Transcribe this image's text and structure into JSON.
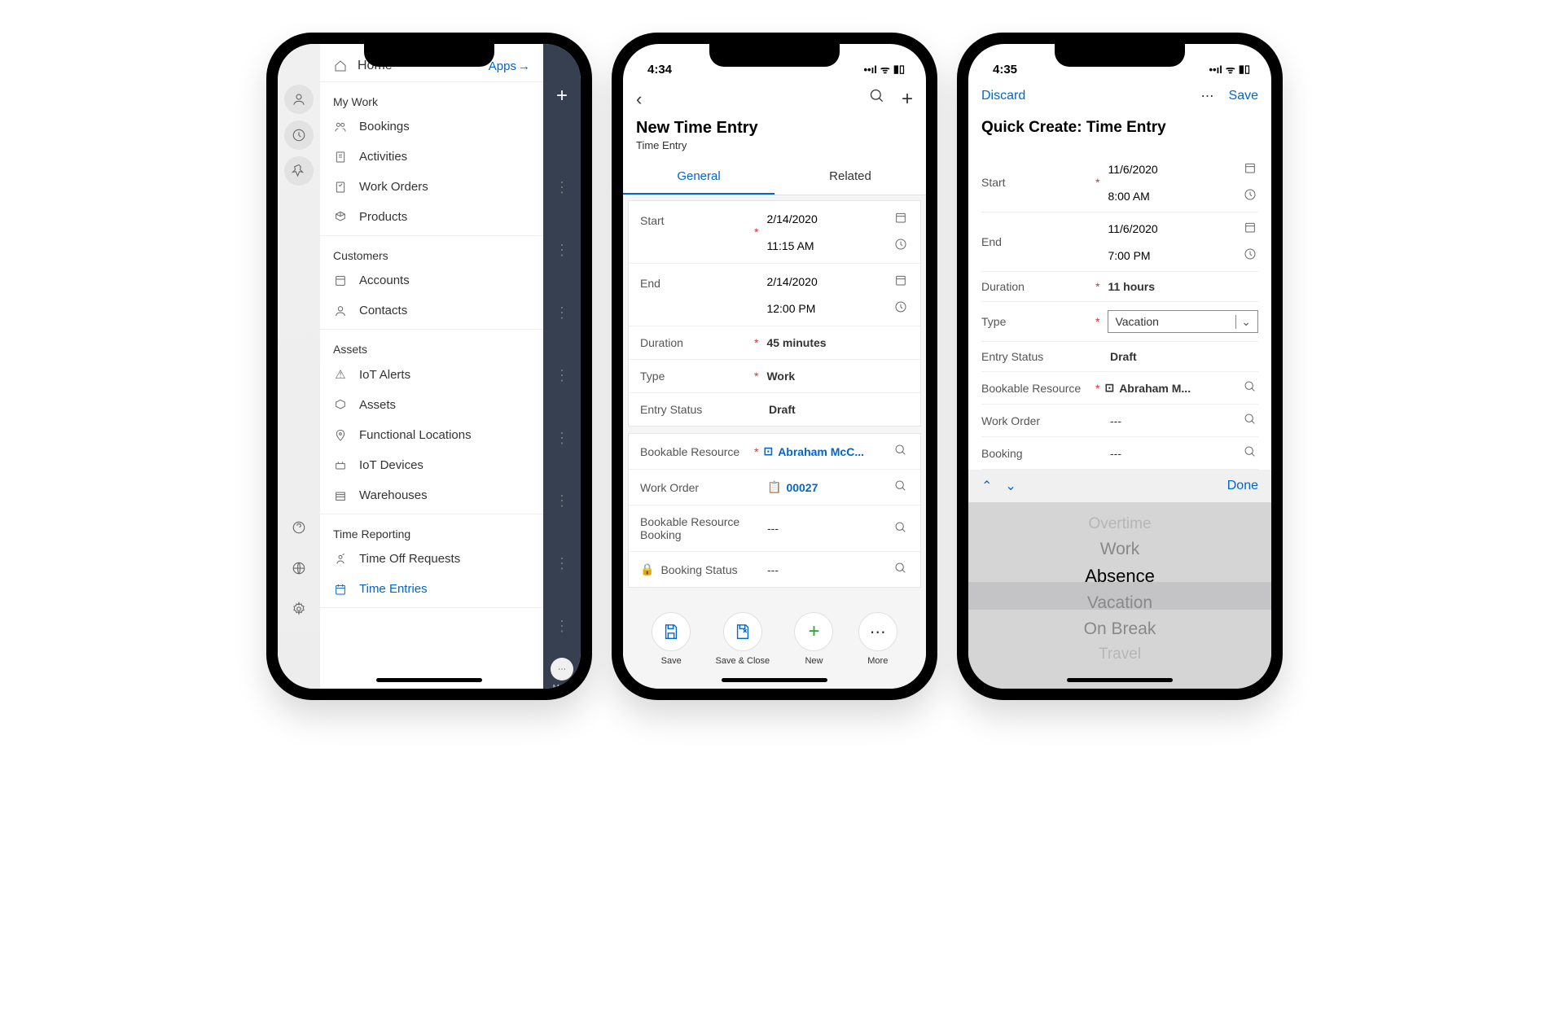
{
  "phone1": {
    "home": "Home",
    "apps": "Apps",
    "sections": {
      "myWork": {
        "title": "My Work",
        "items": [
          "Bookings",
          "Activities",
          "Work Orders",
          "Products"
        ]
      },
      "customers": {
        "title": "Customers",
        "items": [
          "Accounts",
          "Contacts"
        ]
      },
      "assets": {
        "title": "Assets",
        "items": [
          "IoT Alerts",
          "Assets",
          "Functional Locations",
          "IoT Devices",
          "Warehouses"
        ]
      },
      "timeReporting": {
        "title": "Time Reporting",
        "items": [
          "Time Off Requests",
          "Time Entries"
        ]
      }
    },
    "moreLabel": "More"
  },
  "phone2": {
    "time": "4:34",
    "title": "New Time Entry",
    "subtitle": "Time Entry",
    "tabs": {
      "general": "General",
      "related": "Related"
    },
    "fields": {
      "start": {
        "label": "Start",
        "date": "2/14/2020",
        "time": "11:15 AM"
      },
      "end": {
        "label": "End",
        "date": "2/14/2020",
        "time": "12:00 PM"
      },
      "duration": {
        "label": "Duration",
        "value": "45 minutes"
      },
      "type": {
        "label": "Type",
        "value": "Work"
      },
      "entryStatus": {
        "label": "Entry Status",
        "value": "Draft"
      },
      "bookableResource": {
        "label": "Bookable Resource",
        "value": "Abraham McC..."
      },
      "workOrder": {
        "label": "Work Order",
        "value": "00027"
      },
      "brBooking": {
        "label": "Bookable Resource Booking",
        "value": "---"
      },
      "bookingStatus": {
        "label": "Booking Status",
        "value": "---"
      }
    },
    "actions": {
      "save": "Save",
      "saveClose": "Save & Close",
      "new": "New",
      "more": "More"
    }
  },
  "phone3": {
    "time": "4:35",
    "discard": "Discard",
    "save": "Save",
    "title": "Quick Create: Time Entry",
    "fields": {
      "start": {
        "label": "Start",
        "date": "11/6/2020",
        "time": "8:00 AM"
      },
      "end": {
        "label": "End",
        "date": "11/6/2020",
        "time": "7:00 PM"
      },
      "duration": {
        "label": "Duration",
        "value": "11 hours"
      },
      "type": {
        "label": "Type",
        "value": "Vacation"
      },
      "entryStatus": {
        "label": "Entry Status",
        "value": "Draft"
      },
      "bookableResource": {
        "label": "Bookable Resource",
        "value": "Abraham M..."
      },
      "workOrder": {
        "label": "Work Order",
        "value": "---"
      },
      "booking": {
        "label": "Booking",
        "value": "---"
      }
    },
    "done": "Done",
    "picker": [
      "Overtime",
      "Work",
      "Absence",
      "Vacation",
      "On Break",
      "Travel"
    ]
  }
}
